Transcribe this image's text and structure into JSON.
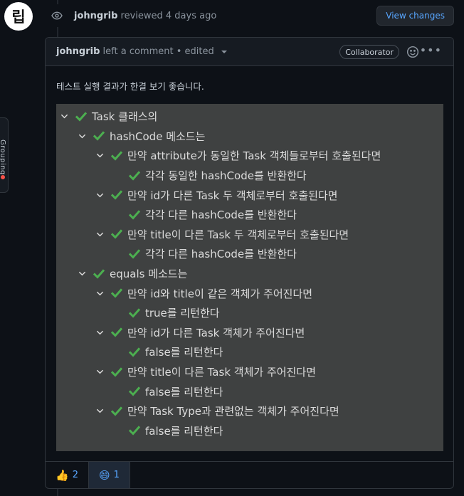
{
  "left_avatar": {
    "text": "립"
  },
  "side_tab": {
    "text": "Grouping"
  },
  "review": {
    "author": "johngrib",
    "verb": "reviewed 4 days ago",
    "view_changes_label": "View changes"
  },
  "comment": {
    "author": "johngrib",
    "meta": "left a comment • edited",
    "role_badge": "Collaborator",
    "intro": "테스트 실행 결과가 한결 보기 좋습니다.",
    "tree": [
      {
        "level": 0,
        "chevron": true,
        "text": "Task 클래스의"
      },
      {
        "level": 1,
        "chevron": true,
        "text": "hashCode 메소드는"
      },
      {
        "level": 2,
        "chevron": true,
        "text": "만약 attribute가 동일한 Task 객체들로부터 호출된다면"
      },
      {
        "level": 3,
        "chevron": false,
        "text": "각각 동일한 hashCode를 반환한다"
      },
      {
        "level": 2,
        "chevron": true,
        "text": "만약 id가 다른 Task 두 객체로부터 호출된다면"
      },
      {
        "level": 3,
        "chevron": false,
        "text": "각각 다른 hashCode를 반환한다"
      },
      {
        "level": 2,
        "chevron": true,
        "text": "만약 title이 다른 Task 두 객체로부터 호출된다면"
      },
      {
        "level": 3,
        "chevron": false,
        "text": "각각 다른 hashCode를 반환한다"
      },
      {
        "level": 1,
        "chevron": true,
        "text": "equals 메소드는"
      },
      {
        "level": 2,
        "chevron": true,
        "text": "만약 id와 title이 같은 객체가 주어진다면"
      },
      {
        "level": 3,
        "chevron": false,
        "text": "true를 리턴한다"
      },
      {
        "level": 2,
        "chevron": true,
        "text": "만약 id가 다른 Task 객체가 주어진다면"
      },
      {
        "level": 3,
        "chevron": false,
        "text": "false를 리턴한다"
      },
      {
        "level": 2,
        "chevron": true,
        "text": "만약 title이 다른 Task 객체가 주어진다면"
      },
      {
        "level": 3,
        "chevron": false,
        "text": "false를 리턴한다"
      },
      {
        "level": 2,
        "chevron": true,
        "text": "만약 Task Type과 관련없는 객체가 주어진다면"
      },
      {
        "level": 3,
        "chevron": false,
        "text": "false를 리턴한다"
      }
    ],
    "reactions": [
      {
        "emoji": "👍",
        "count": "2",
        "selected": false
      },
      {
        "emoji": "😄",
        "count": "1",
        "selected": true
      }
    ]
  },
  "colors": {
    "check": "#4caf50",
    "link": "#58a6ff",
    "tree_bg": "#3f4141"
  }
}
